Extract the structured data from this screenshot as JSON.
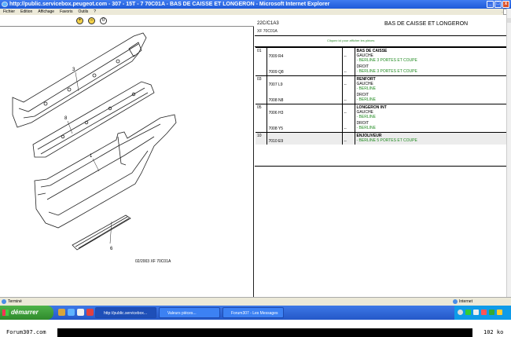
{
  "window": {
    "title": "http://public.servicebox.peugeot.com - 307 - 15T - 7 70C01A - BAS DE CAISSE ET LONGERON - Microsoft Internet Explorer"
  },
  "menu": [
    "Fichier",
    "Edition",
    "Affichage",
    "Favoris",
    "Outils",
    "?"
  ],
  "menu_right": "...",
  "drawing": {
    "reference": "02/2003 XF 70C01A",
    "callouts": [
      "3",
      "8",
      "1",
      "6"
    ]
  },
  "right_panel": {
    "code": "22C/C1A3",
    "subtitle": "XF 70C01A",
    "title": "BAS DE CAISSE ET LONGERON",
    "link": "Cliquez ici pour afficher les pièces",
    "rows": [
      {
        "num": "01",
        "ref": "7009 R4",
        "qty": "--",
        "desc": "BAS DE CAISSE",
        "sub": "GAUCHE",
        "note": "- BERLINE 3 PORTES ET COUPE",
        "shade": false,
        "group": true
      },
      {
        "num": "",
        "ref": "7009 Q8",
        "qty": "--",
        "desc": "",
        "sub": "DROIT",
        "note": "- BERLINE 3 PORTES ET COUPE",
        "shade": false,
        "group": false
      },
      {
        "num": "03",
        "ref": "7007 L9",
        "qty": "--",
        "desc": "RENFORT",
        "sub": "GAUCHE",
        "note": "- BERLINE",
        "shade": false,
        "group": true
      },
      {
        "num": "",
        "ref": "7008 N8",
        "qty": "--",
        "desc": "",
        "sub": "DROIT",
        "note": "- BERLINE",
        "shade": false,
        "group": false
      },
      {
        "num": "05",
        "ref": "7006 H3",
        "qty": "--",
        "desc": "LONGERON INT",
        "sub": "GAUCHE",
        "note": "- BERLINE",
        "shade": false,
        "group": true
      },
      {
        "num": "",
        "ref": "7008 Y5",
        "qty": "--",
        "desc": "",
        "sub": "DROIT",
        "note": "- BERLINE",
        "shade": false,
        "group": false
      },
      {
        "num": "10",
        "ref": "7010 E9",
        "qty": "--",
        "desc": "ENJOLIVEUR",
        "sub": "",
        "note": "- BERLINE 5 PORTES ET COUPE",
        "shade": true,
        "group": true
      }
    ]
  },
  "statusbar": {
    "left": "Terminé",
    "right": "Internet"
  },
  "taskbar": {
    "start": "démarrer",
    "tasks": [
      "http://public.servicebox...",
      "Valeurs pièces...",
      "Forum307 - Les Messages"
    ]
  },
  "watermark": {
    "left": "Forum307.com",
    "right": "102 ko"
  },
  "colors": {
    "title_blue": "#1f5ad8",
    "start_green": "#3a9a36",
    "link_green": "#1f8a1f",
    "tray_blue": "#0f9be8"
  }
}
